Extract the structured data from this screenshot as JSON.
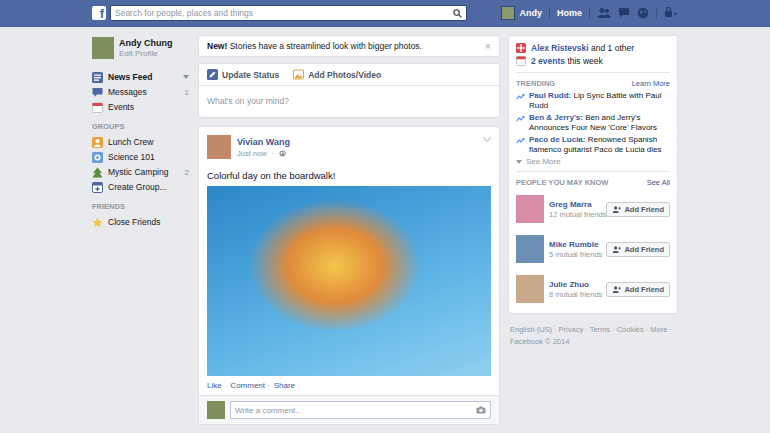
{
  "topbar": {
    "logo": "f",
    "search": {
      "placeholder": "Search for people, places and things"
    },
    "user": "Andy",
    "home": "Home"
  },
  "sidebar": {
    "profile": {
      "name": "Andy Chung",
      "edit": "Edit Profile"
    },
    "nav": [
      {
        "label": "News Feed",
        "selected": true
      },
      {
        "label": "Messages",
        "selected": false,
        "count": "1"
      },
      {
        "label": "Events",
        "selected": false
      }
    ],
    "sections": [
      {
        "title": "GROUPS",
        "items": [
          {
            "label": "Lunch Crew"
          },
          {
            "label": "Science 101"
          },
          {
            "label": "Mystic Camping",
            "count": "2"
          },
          {
            "label": "Create Group..."
          }
        ]
      },
      {
        "title": "FRIENDS",
        "items": [
          {
            "label": "Close Friends"
          }
        ]
      }
    ]
  },
  "notice": {
    "tag": "New!",
    "text": "Stories have a streamlined look with bigger photos.",
    "close": "×"
  },
  "composer": {
    "actions": [
      "Update Status",
      "Add Photos/Video"
    ],
    "placeholder": "What's on your mind?"
  },
  "post": {
    "author": "Vivian Wang",
    "time": "Just now",
    "separator": "·",
    "text": "Colorful day on the boardwalk!",
    "actions": [
      "Like",
      "Comment",
      "Share"
    ],
    "comment_placeholder": "Write a comment..."
  },
  "right": {
    "events": [
      {
        "bold": "Alex Ristevski",
        "rest": "and 1 other"
      },
      {
        "bold": "2 events",
        "rest": "this week"
      }
    ],
    "trending": {
      "title": "TRENDING",
      "link": "Learn More",
      "items": [
        {
          "topic": "Paul Rudd:",
          "text": "Lip Sync Battle with Paul Rudd"
        },
        {
          "topic": "Ben & Jerry's:",
          "text": "Ben and Jerry's Announces Four New 'Core' Flavors"
        },
        {
          "topic": "Paco de Lucia:",
          "text": "Renowned Spanish flamenco guitarist Paco de Lucia dies"
        }
      ],
      "more": "See More"
    },
    "people": {
      "title": "PEOPLE YOU MAY KNOW",
      "link": "See All",
      "items": [
        {
          "name": "Greg Marra",
          "mutual": "12 mutual friends",
          "button": "Add Friend"
        },
        {
          "name": "Mike Rumble",
          "mutual": "5 mutual friends",
          "button": "Add Friend"
        },
        {
          "name": "Julie Zhuo",
          "mutual": "8 mutual friends",
          "button": "Add Friend"
        }
      ]
    }
  },
  "footer": {
    "links": [
      "English (US)",
      "Privacy",
      "Terms",
      "Cookies",
      "More"
    ],
    "separator": "·",
    "copyright": "Facebook © 2014"
  }
}
